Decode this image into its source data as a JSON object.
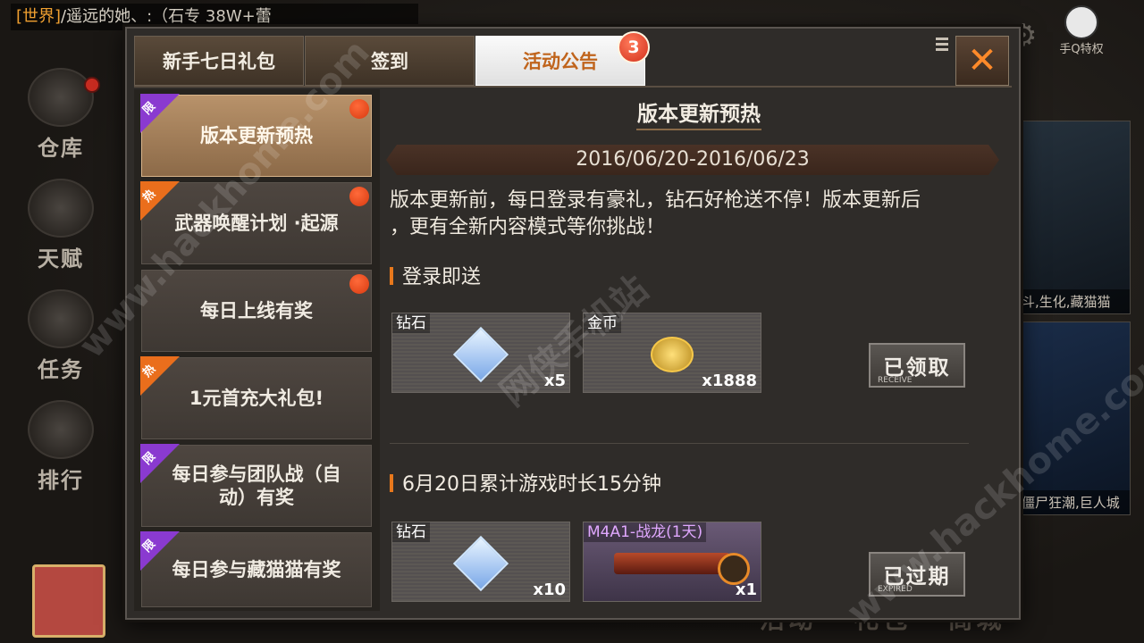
{
  "background": {
    "chat": {
      "channel": "[世界]",
      "text": "/遥远的她、:（石专",
      "tail": "38W+蕾"
    },
    "left_nav": [
      "仓库",
      "天赋",
      "任务",
      "排行"
    ],
    "right_captions": [
      "斗,生化,藏猫猫",
      "僵尸狂潮,巨人城"
    ],
    "top_right_label": "手Q特权",
    "bottom_bar": [
      "活动",
      "礼包",
      "商城"
    ]
  },
  "tabs": [
    {
      "label": "新手七日礼包"
    },
    {
      "label": "签到"
    },
    {
      "label": "活动公告",
      "badge": "3"
    }
  ],
  "close_symbol": "✕",
  "events": [
    {
      "label": "版本更新预热",
      "ribbon": "限",
      "ribbon_color": "#8a3ad0",
      "dot": true
    },
    {
      "label": "武器唤醒计划 ·起源",
      "ribbon": "热",
      "ribbon_color": "#ea6e1c",
      "dot": true
    },
    {
      "label": "每日上线有奖",
      "ribbon": "",
      "dot": true
    },
    {
      "label": "1元首充大礼包!",
      "ribbon": "热",
      "ribbon_color": "#ea6e1c",
      "dot": false
    },
    {
      "label": "每日参与团队战（自动）有奖",
      "ribbon": "限",
      "ribbon_color": "#8a3ad0",
      "dot": false
    },
    {
      "label": "每日参与藏猫猫有奖",
      "ribbon": "限",
      "ribbon_color": "#8a3ad0",
      "dot": false
    }
  ],
  "detail": {
    "title": "版本更新预热",
    "date_range": "2016/06/20-2016/06/23",
    "description_line1": "版本更新前，每日登录有豪礼，钻石好枪送不停！版本更新后",
    "description_line2": "，更有全新内容模式等你挑战！",
    "sections": [
      {
        "heading": "登录即送",
        "rewards": [
          {
            "name": "钻石",
            "qty": "x5",
            "icon": "diamond-icon"
          },
          {
            "name": "金币",
            "qty": "x1888",
            "icon": "gold-coins-icon"
          }
        ],
        "status_cn": "已领取",
        "status_en": "RECEIVE"
      },
      {
        "heading": "6月20日累计游戏时长15分钟",
        "rewards": [
          {
            "name": "钻石",
            "qty": "x10",
            "icon": "diamond-icon"
          },
          {
            "name": "M4A1-战龙(1天)",
            "qty": "x1",
            "icon": "rifle-icon"
          }
        ],
        "status_cn": "已过期",
        "status_en": "EXPIRED"
      }
    ]
  },
  "watermarks": [
    "www.hackhome.com",
    "网侠手机站",
    "www.hackhome.com"
  ]
}
